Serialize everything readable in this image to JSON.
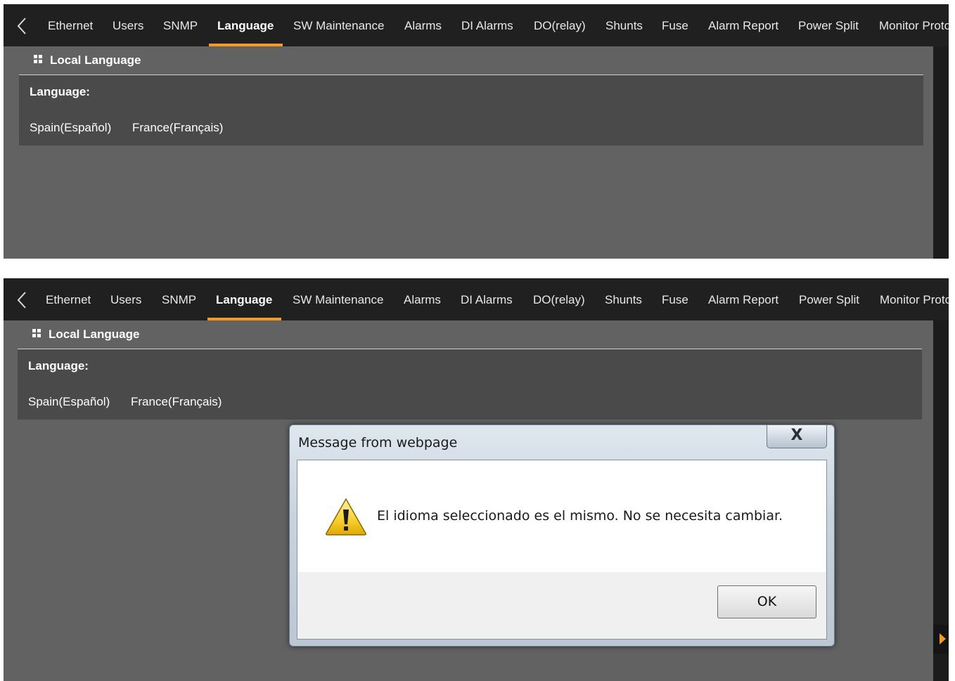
{
  "tabs": [
    {
      "label": "Ethernet"
    },
    {
      "label": "Users"
    },
    {
      "label": "SNMP"
    },
    {
      "label": "Language"
    },
    {
      "label": "SW Maintenance"
    },
    {
      "label": "Alarms"
    },
    {
      "label": "DI Alarms"
    },
    {
      "label": "DO(relay)"
    },
    {
      "label": "Shunts"
    },
    {
      "label": "Fuse"
    },
    {
      "label": "Alarm Report"
    },
    {
      "label": "Power Split"
    },
    {
      "label": "Monitor Protocol"
    }
  ],
  "active_tab": "Language",
  "section": {
    "title": "Local Language"
  },
  "language": {
    "label": "Language:",
    "options": [
      "Spain(Español)",
      "France(Français)"
    ]
  },
  "dialog": {
    "title": "Message from webpage",
    "close_glyph": "X",
    "message": "El idioma seleccionado es el mismo. No se necesita cambiar.",
    "ok_label": "OK"
  },
  "colors": {
    "accent": "#f59a23",
    "tabbar": "#202020",
    "panel": "#626262",
    "content_box": "#4a4a4a"
  }
}
